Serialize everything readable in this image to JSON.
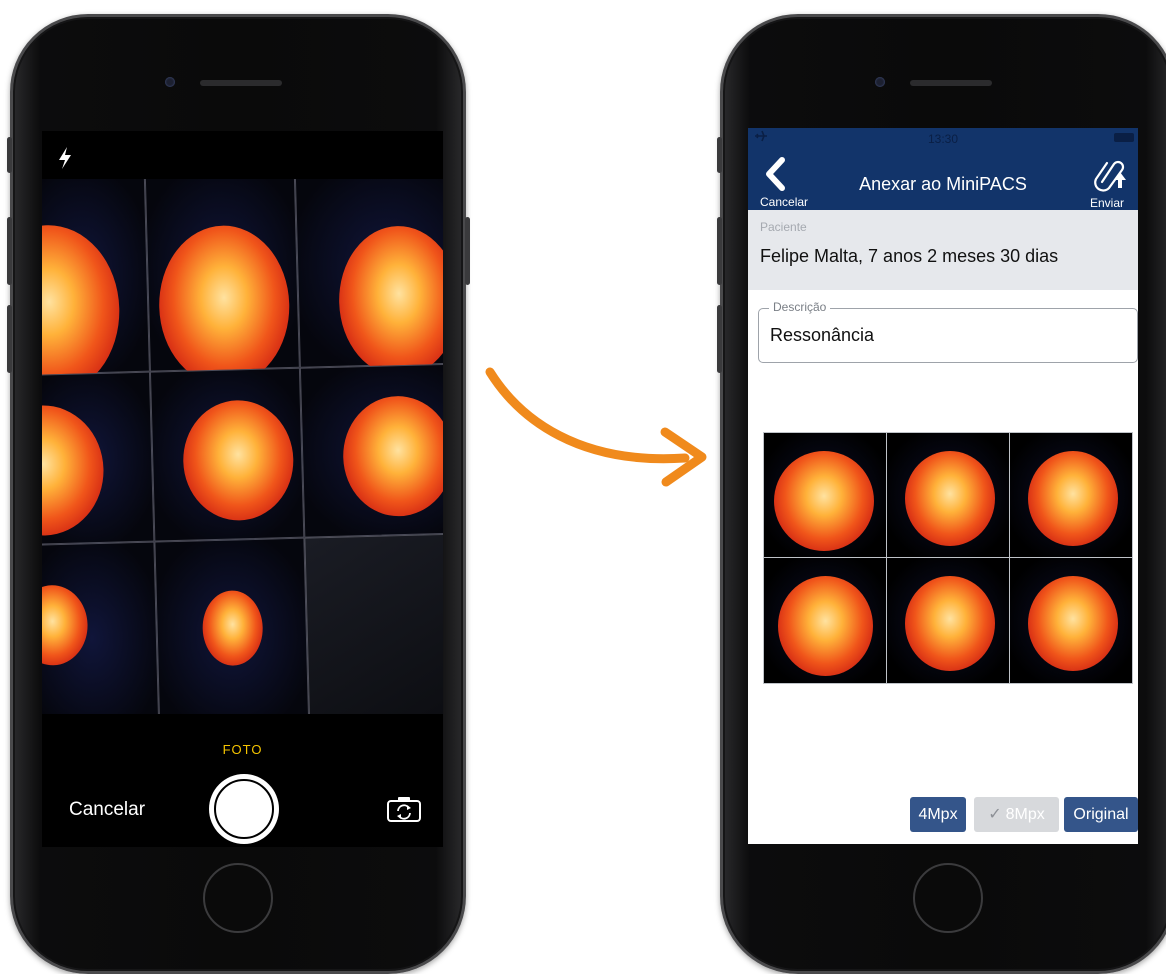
{
  "camera": {
    "mode_label": "FOTO",
    "cancel_label": "Cancelar",
    "icons": {
      "flash": "flash-icon",
      "shutter": "shutter-button",
      "flip": "switch-camera-icon"
    }
  },
  "app": {
    "status_time": "13:30",
    "nav": {
      "back_label": "Cancelar",
      "title": "Anexar ao MiniPACS",
      "send_label": "Enviar"
    },
    "patient": {
      "label": "Paciente",
      "name": "Felipe Malta, 7 anos 2 meses 30 dias"
    },
    "description": {
      "label": "Descrição",
      "value": "Ressonância"
    },
    "resolution_options": [
      {
        "label": "4Mpx",
        "selected": false
      },
      {
        "label": "8Mpx",
        "selected": true
      },
      {
        "label": "Original",
        "selected": false
      }
    ],
    "colors": {
      "nav_bg": "#12346a",
      "button_bg": "#34558a",
      "accent_arrow": "#f08a1c",
      "foto_label": "#f5c400"
    }
  }
}
